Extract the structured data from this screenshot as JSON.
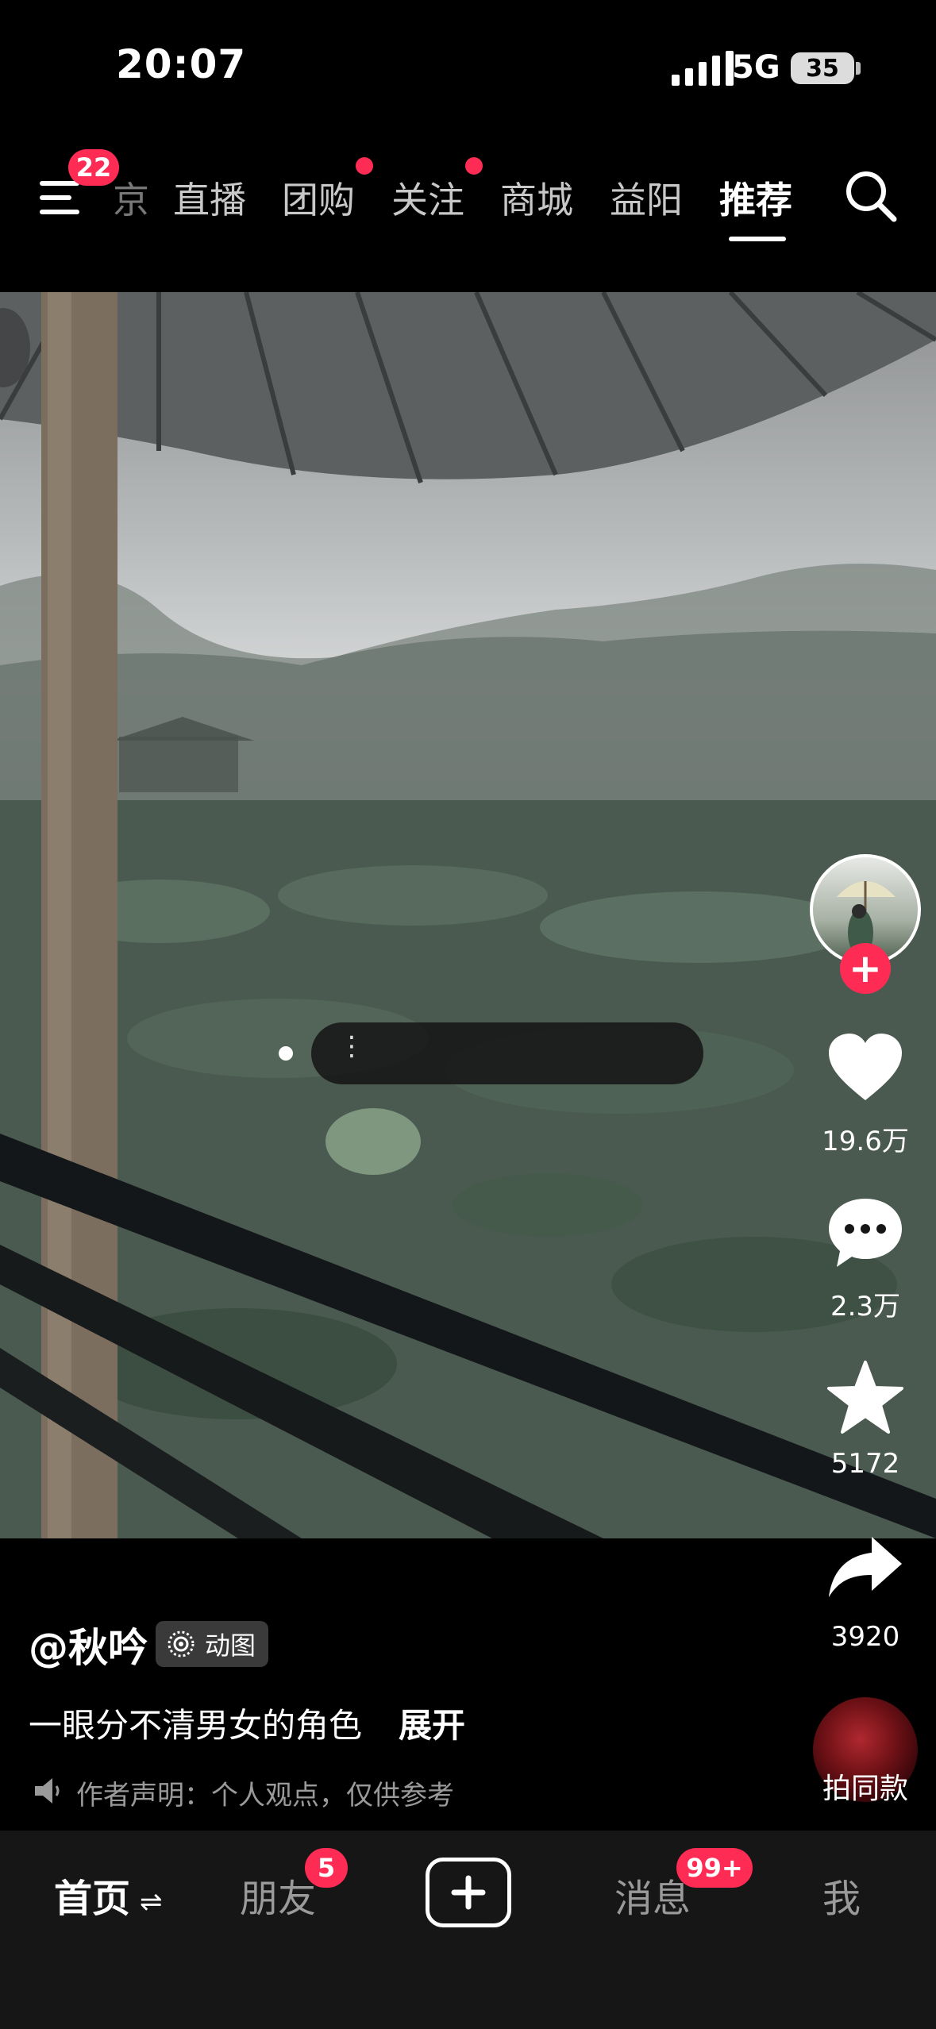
{
  "status_bar": {
    "time": "20:07",
    "network": "5G",
    "battery": "35"
  },
  "top_nav": {
    "menu_badge": "22",
    "clipped_tab": "京",
    "tabs": [
      {
        "label": "直播",
        "dot": false
      },
      {
        "label": "团购",
        "dot": true
      },
      {
        "label": "关注",
        "dot": true
      },
      {
        "label": "商城",
        "dot": false
      },
      {
        "label": "益阳",
        "dot": false
      },
      {
        "label": "推荐",
        "active": true
      }
    ]
  },
  "actions": {
    "likes": "19.6万",
    "comments": "2.3万",
    "favorites": "5172",
    "shares": "3920",
    "remix_label": "拍同款"
  },
  "post": {
    "author": "@秋吟",
    "tag": "动图",
    "description": "一眼分不清男女的角色",
    "expand": "展开",
    "notice": "作者声明：个人观点，仅供参考"
  },
  "bottom_tabs": {
    "home": "首页",
    "friends": "朋友",
    "friends_badge": "5",
    "messages": "消息",
    "messages_badge": "99+",
    "me": "我"
  },
  "colors": {
    "accent": "#fe2c55",
    "background": "#000000",
    "tabbar": "#161616"
  }
}
